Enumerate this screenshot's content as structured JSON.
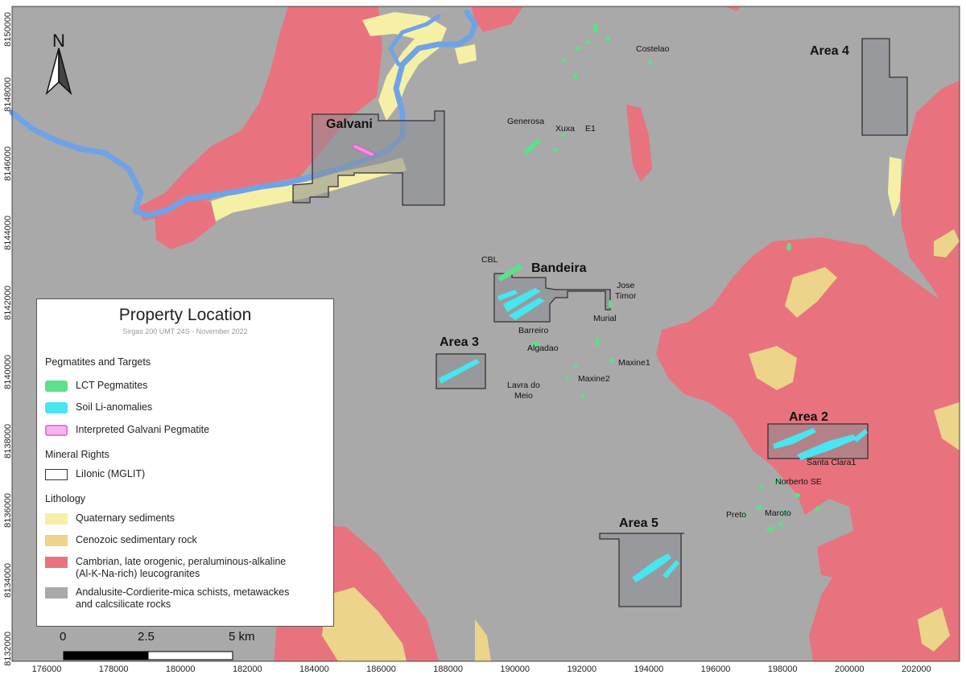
{
  "map": {
    "y_ticks": [
      "8132000",
      "8134000",
      "8136000",
      "8138000",
      "8140000",
      "8142000",
      "8144000",
      "8146000",
      "8148000",
      "8150000"
    ],
    "x_ticks": [
      "176000",
      "178000",
      "180000",
      "182000",
      "184000",
      "186000",
      "188000",
      "190000",
      "192000",
      "194000",
      "196000",
      "198000",
      "200000",
      "202000"
    ],
    "north_label": "N",
    "scale_bar": {
      "labels": [
        "0",
        "2.5",
        "5 km"
      ]
    },
    "areas": [
      {
        "id": "galvani",
        "name": "Galvani"
      },
      {
        "id": "bandeira",
        "name": "Bandeira"
      },
      {
        "id": "area3",
        "name": "Area 3"
      },
      {
        "id": "area4",
        "name": "Area 4"
      },
      {
        "id": "area2",
        "name": "Area 2"
      },
      {
        "id": "area5",
        "name": "Area 5"
      }
    ],
    "places": [
      {
        "id": "costelao",
        "name": "Costelao"
      },
      {
        "id": "generosa",
        "name": "Generosa"
      },
      {
        "id": "xuxa",
        "name": "Xuxa"
      },
      {
        "id": "e1",
        "name": "E1"
      },
      {
        "id": "cbl",
        "name": "CBL"
      },
      {
        "id": "jose-timor",
        "name": "Jose\nTimor"
      },
      {
        "id": "murial",
        "name": "Murial"
      },
      {
        "id": "barreiro",
        "name": "Barreiro"
      },
      {
        "id": "algadao",
        "name": "Algadao"
      },
      {
        "id": "maxine1",
        "name": "Maxine1"
      },
      {
        "id": "maxine2",
        "name": "Maxine2"
      },
      {
        "id": "lavra-do-meio",
        "name": "Lavra do\nMeio"
      },
      {
        "id": "santa-clara1",
        "name": "Santa Clara1"
      },
      {
        "id": "norberto-se",
        "name": "Norberto SE"
      },
      {
        "id": "preto",
        "name": "Preto"
      },
      {
        "id": "maroto",
        "name": "Maroto"
      }
    ],
    "colors": {
      "schist": "#a9a9a9",
      "granite": "#e8737e",
      "quaternary": "#f6f0a6",
      "cenozoic": "#ecd48a",
      "river": "#6fa3e6",
      "lct": "#5de08a",
      "soil_li": "#47e6f0",
      "galvani_pegmatite": "#f08fe0",
      "property_fill": "#8a8d92",
      "property_edge": "#333333"
    }
  },
  "legend": {
    "title": "Property Location",
    "subtitle": "Sirgas 200 UMT 24S - November 2022",
    "section_pegmatites": "Pegmatites and Targets",
    "lct": "LCT Pegmatites",
    "soil": "Soil Li-anomalies",
    "galvani_pegmatite": "Interpreted Galvani Pegmatite",
    "section_rights": "Mineral Rights",
    "lionic": "LiIonic (MGLIT)",
    "section_lithology": "Lithology",
    "quaternary": "Quaternary sediments",
    "cenozoic": "Cenozoic sedimentary rock",
    "granite": "Cambrian, late orogenic, peraluminous-alkaline\n(Al-K-Na-rich) leucogranites",
    "schist": "Andalusite-Cordierite-mica schists, metawackes\nand calcsilicate rocks"
  }
}
